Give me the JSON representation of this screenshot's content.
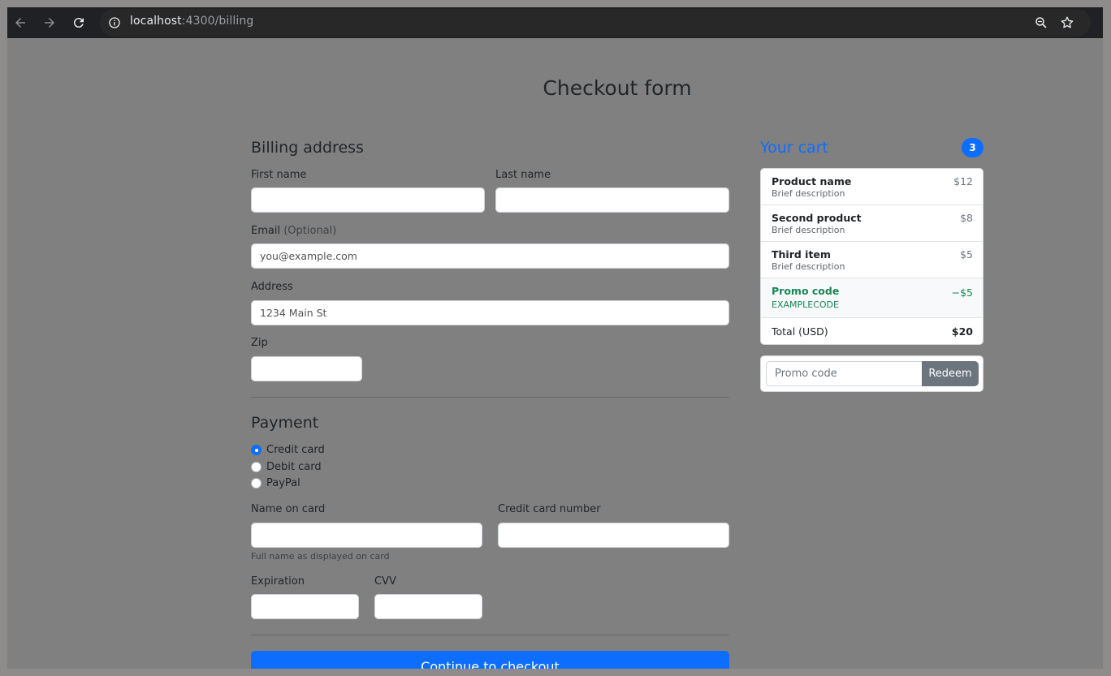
{
  "browser": {
    "url_host": "localhost",
    "url_path": ":4300/billing"
  },
  "page": {
    "title": "Checkout form"
  },
  "billing": {
    "title": "Billing address",
    "first_name_label": "First name",
    "last_name_label": "Last name",
    "email_label": "Email",
    "email_optional": "(Optional)",
    "email_placeholder": "you@example.com",
    "address_label": "Address",
    "address_placeholder": "1234 Main St",
    "zip_label": "Zip"
  },
  "payment": {
    "title": "Payment",
    "methods": [
      {
        "label": "Credit card",
        "checked": true
      },
      {
        "label": "Debit card",
        "checked": false
      },
      {
        "label": "PayPal",
        "checked": false
      }
    ],
    "name_on_card_label": "Name on card",
    "name_on_card_help": "Full name as displayed on card",
    "card_number_label": "Credit card number",
    "expiration_label": "Expiration",
    "cvv_label": "CVV"
  },
  "checkout_button": "Continue to checkout",
  "cart": {
    "title": "Your cart",
    "count": "3",
    "items": [
      {
        "name": "Product name",
        "desc": "Brief description",
        "price": "$12"
      },
      {
        "name": "Second product",
        "desc": "Brief description",
        "price": "$8"
      },
      {
        "name": "Third item",
        "desc": "Brief description",
        "price": "$5"
      }
    ],
    "promo": {
      "name": "Promo code",
      "code": "EXAMPLECODE",
      "amount": "−$5"
    },
    "total_label": "Total (USD)",
    "total_value": "$20",
    "redeem_placeholder": "Promo code",
    "redeem_button": "Redeem"
  },
  "colors": {
    "primary": "#0d6efd",
    "success": "#198754",
    "secondary": "#6c757d"
  }
}
